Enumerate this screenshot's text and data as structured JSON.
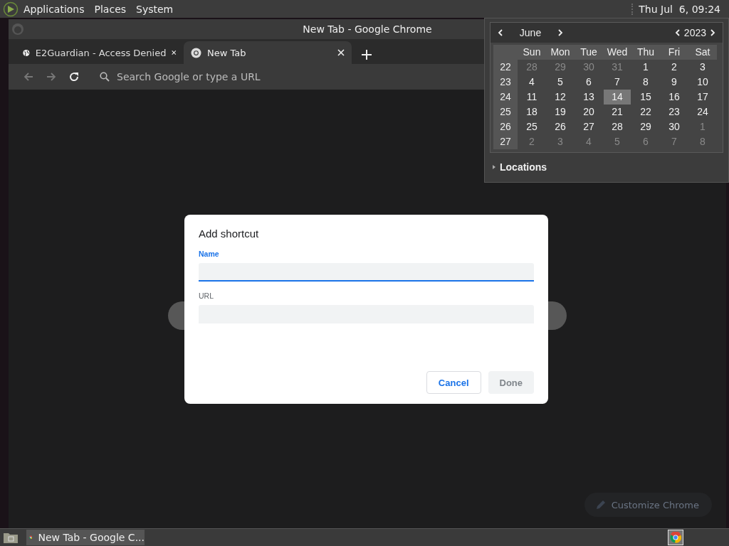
{
  "top_panel": {
    "menus": [
      "Applications",
      "Places",
      "System"
    ],
    "clock": "Thu Jul  6, 09:24"
  },
  "window": {
    "title": "New Tab - Google Chrome"
  },
  "tabs": [
    {
      "label": "E2Guardian - Access Denied",
      "selected": false
    },
    {
      "label": "New Tab",
      "selected": true
    }
  ],
  "address_bar": {
    "placeholder": "Search Google or type a URL"
  },
  "new_tab_page": {
    "customize_button": "Customize Chrome"
  },
  "dialog": {
    "title": "Add shortcut",
    "fields": [
      {
        "label": "Name",
        "focused": true
      },
      {
        "label": "URL",
        "focused": false
      }
    ],
    "buttons": [
      {
        "label": "Cancel",
        "disabled": false
      },
      {
        "label": "Done",
        "disabled": true
      }
    ]
  },
  "calendar": {
    "month": "June",
    "year": "2023",
    "weekdays": [
      "Sun",
      "Mon",
      "Tue",
      "Wed",
      "Thu",
      "Fri",
      "Sat"
    ],
    "weeks": [
      {
        "week": "22",
        "days": [
          {
            "day": "28",
            "outside_month": true,
            "selected": false
          },
          {
            "day": "29",
            "outside_month": true,
            "selected": false
          },
          {
            "day": "30",
            "outside_month": true,
            "selected": false
          },
          {
            "day": "31",
            "outside_month": true,
            "selected": false
          },
          {
            "day": "1",
            "outside_month": false,
            "selected": false
          },
          {
            "day": "2",
            "outside_month": false,
            "selected": false
          },
          {
            "day": "3",
            "outside_month": false,
            "selected": false
          }
        ]
      },
      {
        "week": "23",
        "days": [
          {
            "day": "4",
            "outside_month": false,
            "selected": false
          },
          {
            "day": "5",
            "outside_month": false,
            "selected": false
          },
          {
            "day": "6",
            "outside_month": false,
            "selected": false
          },
          {
            "day": "7",
            "outside_month": false,
            "selected": false
          },
          {
            "day": "8",
            "outside_month": false,
            "selected": false
          },
          {
            "day": "9",
            "outside_month": false,
            "selected": false
          },
          {
            "day": "10",
            "outside_month": false,
            "selected": false
          }
        ]
      },
      {
        "week": "24",
        "days": [
          {
            "day": "11",
            "outside_month": false,
            "selected": false
          },
          {
            "day": "12",
            "outside_month": false,
            "selected": false
          },
          {
            "day": "13",
            "outside_month": false,
            "selected": false
          },
          {
            "day": "14",
            "outside_month": false,
            "selected": true
          },
          {
            "day": "15",
            "outside_month": false,
            "selected": false
          },
          {
            "day": "16",
            "outside_month": false,
            "selected": false
          },
          {
            "day": "17",
            "outside_month": false,
            "selected": false
          }
        ]
      },
      {
        "week": "25",
        "days": [
          {
            "day": "18",
            "outside_month": false,
            "selected": false
          },
          {
            "day": "19",
            "outside_month": false,
            "selected": false
          },
          {
            "day": "20",
            "outside_month": false,
            "selected": false
          },
          {
            "day": "21",
            "outside_month": false,
            "selected": false
          },
          {
            "day": "22",
            "outside_month": false,
            "selected": false
          },
          {
            "day": "23",
            "outside_month": false,
            "selected": false
          },
          {
            "day": "24",
            "outside_month": false,
            "selected": false
          }
        ]
      },
      {
        "week": "26",
        "days": [
          {
            "day": "25",
            "outside_month": false,
            "selected": false
          },
          {
            "day": "26",
            "outside_month": false,
            "selected": false
          },
          {
            "day": "27",
            "outside_month": false,
            "selected": false
          },
          {
            "day": "28",
            "outside_month": false,
            "selected": false
          },
          {
            "day": "29",
            "outside_month": false,
            "selected": false
          },
          {
            "day": "30",
            "outside_month": false,
            "selected": false
          },
          {
            "day": "1",
            "outside_month": true,
            "selected": false
          }
        ]
      },
      {
        "week": "27",
        "days": [
          {
            "day": "2",
            "outside_month": true,
            "selected": false
          },
          {
            "day": "3",
            "outside_month": true,
            "selected": false
          },
          {
            "day": "4",
            "outside_month": true,
            "selected": false
          },
          {
            "day": "5",
            "outside_month": true,
            "selected": false
          },
          {
            "day": "6",
            "outside_month": true,
            "selected": false
          },
          {
            "day": "7",
            "outside_month": true,
            "selected": false
          },
          {
            "day": "8",
            "outside_month": true,
            "selected": false
          }
        ]
      }
    ],
    "locations": "Locations"
  },
  "taskbar": {
    "tasks": [
      {
        "label": "New Tab - Google C...",
        "selected": false
      }
    ]
  }
}
